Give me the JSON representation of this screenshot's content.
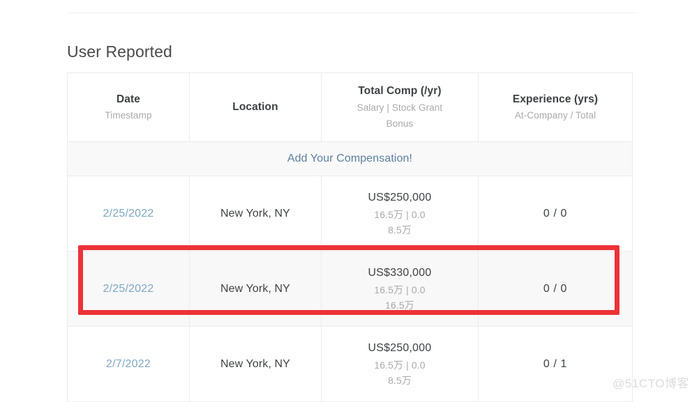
{
  "page": {
    "section_title": "User Reported",
    "watermark": "@51CTO博客"
  },
  "table": {
    "headers": [
      {
        "main": "Date",
        "sub1": "Timestamp",
        "sub2": ""
      },
      {
        "main": "Location",
        "sub1": "",
        "sub2": ""
      },
      {
        "main": "Total Comp (/yr)",
        "sub1": "Salary | Stock Grant",
        "sub2": "Bonus"
      },
      {
        "main": "Experience (yrs)",
        "sub1": "At-Company / Total",
        "sub2": ""
      }
    ],
    "add_row": {
      "label": "Add Your Compensation!",
      "color": "#5b7f9e"
    },
    "rows": [
      {
        "date": "2/25/2022",
        "location": "New York, NY",
        "comp_total": "US$250,000",
        "comp_breakdown": "16.5万 | 0.0",
        "comp_bonus": "8.5万",
        "experience": "0 / 0",
        "highlighted": false
      },
      {
        "date": "2/25/2022",
        "location": "New York, NY",
        "comp_total": "US$330,000",
        "comp_breakdown": "16.5万 | 0.0",
        "comp_bonus": "16.5万",
        "experience": "0 / 0",
        "highlighted": true
      },
      {
        "date": "2/7/2022",
        "location": "New York, NY",
        "comp_total": "US$250,000",
        "comp_breakdown": "16.5万 | 0.0",
        "comp_bonus": "8.5万",
        "experience": "0 / 1",
        "highlighted": false
      }
    ]
  },
  "annotation": {
    "type": "red-rectangle-highlight",
    "color": "#ec3237",
    "target_row_index": 1
  },
  "colors": {
    "link_blue": "#7ea8c4",
    "header_text": "#3c4043",
    "muted_text": "#a9aaad",
    "border": "#ececee",
    "highlight_red": "#ec3237"
  }
}
